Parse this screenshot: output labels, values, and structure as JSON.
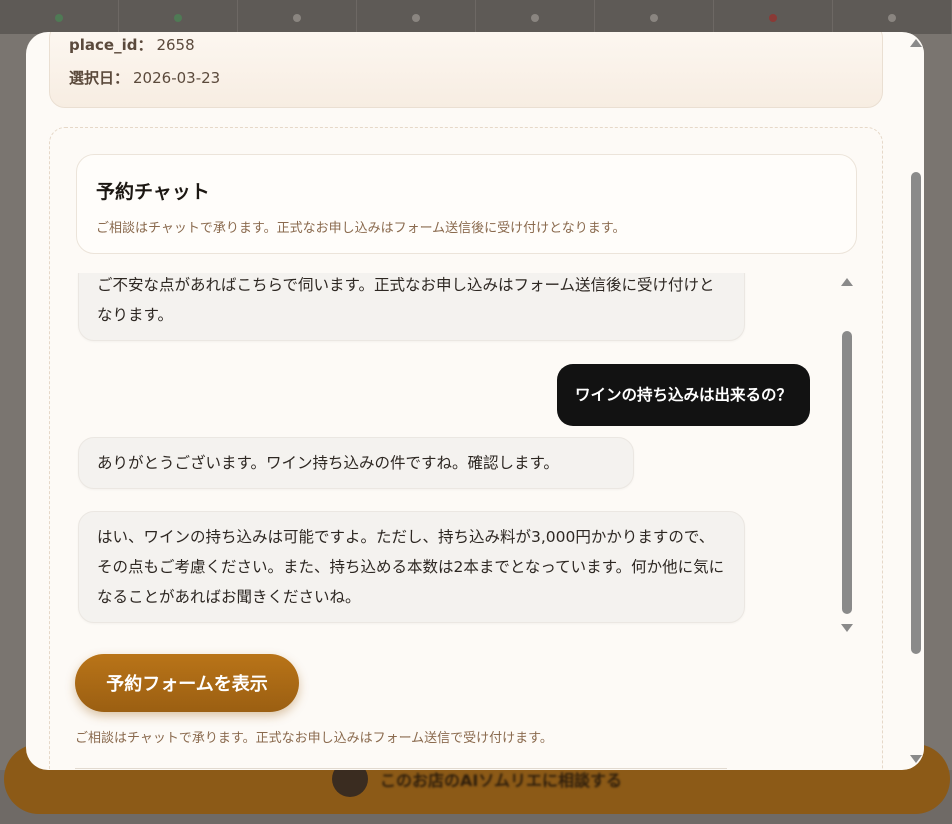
{
  "info": {
    "place_id_label": "place_id：",
    "place_id_value": "2658",
    "date_label": "選択日：",
    "date_value": "2026-03-23"
  },
  "chat": {
    "title": "予約チャット",
    "subtitle": "ご相談はチャットで承ります。正式なお申し込みはフォーム送信後に受け付けとなります。",
    "messages": [
      {
        "role": "bot",
        "text": "ご不安な点があればこちらで伺います。正式なお申し込みはフォーム送信後に受け付けとなります。"
      },
      {
        "role": "user",
        "text": "ワインの持ち込みは出来るの？"
      },
      {
        "role": "bot",
        "text": "ありがとうございます。ワイン持ち込みの件ですね。確認します。"
      },
      {
        "role": "bot",
        "text": "はい、ワインの持ち込みは可能ですよ。ただし、持ち込み料が3,000円かかりますので、その点もご考慮ください。また、持ち込める本数は2本までとなっています。何か他に気になることがあればお聞きくださいね。"
      }
    ],
    "show_form_button": "予約フォームを表示",
    "footnote": "ご相談はチャットで承ります。正式なお申し込みはフォーム送信で受け付けます。"
  },
  "background": {
    "cta_label": "このお店のAIソムリエに相談する"
  },
  "colors": {
    "accent": "#a8681a",
    "user_bubble": "#121212",
    "bot_bubble": "#f4f2ef",
    "muted_text": "#8a6a4e"
  }
}
